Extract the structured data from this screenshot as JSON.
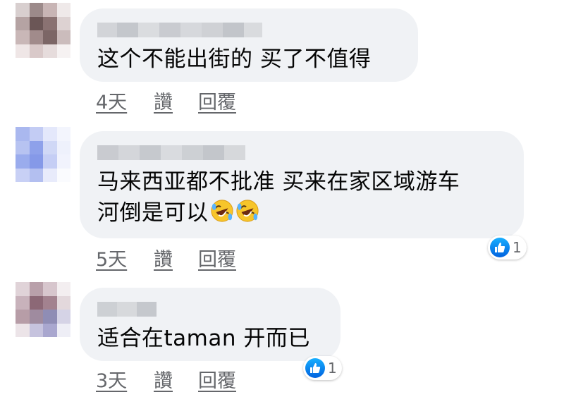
{
  "comments": [
    {
      "text_lines": [
        "这个不能出街的 买了不值得"
      ],
      "time": "4天",
      "like_label": "讚",
      "reply_label": "回覆",
      "reaction_count": null
    },
    {
      "text_lines": [
        "马来西亚都不批准  买来在家区域游车",
        "河倒是可以"
      ],
      "time": "5天",
      "like_label": "讚",
      "reply_label": "回覆",
      "reaction_count": "1",
      "emojis": [
        "rolling-on-floor-laughing-icon",
        "rolling-on-floor-laughing-icon"
      ]
    },
    {
      "text_lines": [
        "适合在taman 开而已"
      ],
      "time": "3天",
      "like_label": "讚",
      "reply_label": "回覆",
      "reaction_count": "1"
    }
  ],
  "colors": {
    "bubble": "#f0f2f5",
    "text": "#050505",
    "meta": "#65676b",
    "like_blue": "#1877f2"
  }
}
